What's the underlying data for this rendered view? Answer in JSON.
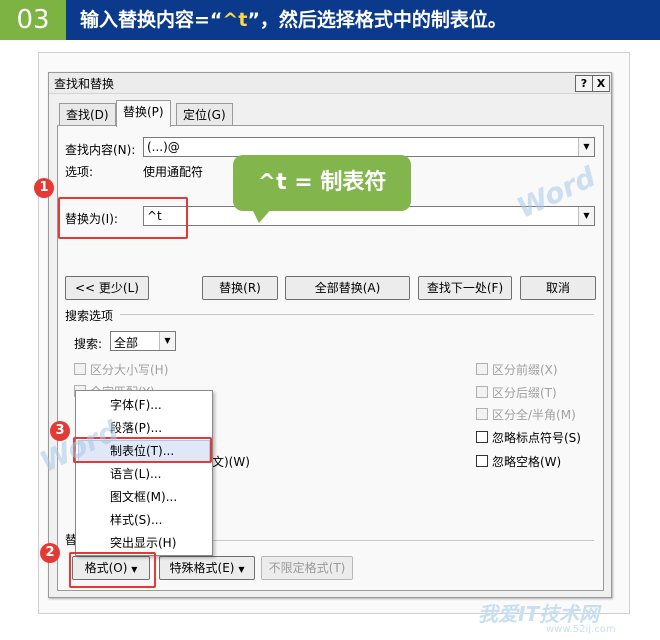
{
  "banner": {
    "step_number": "03",
    "text_before": "输入替换内容=“",
    "text_highlight": "^t",
    "text_after": "”，然后选择格式中的制表位。",
    "colors": {
      "bar": "#0b3a8d",
      "number_bg": "#7cb342",
      "highlight": "#ffd54a"
    }
  },
  "dialog": {
    "title": "查找和替换",
    "help_button": "?",
    "close_button": "X",
    "tabs": [
      {
        "label": "查找(D)"
      },
      {
        "label": "替换(P)"
      },
      {
        "label": "定位(G)"
      }
    ],
    "find": {
      "label": "查找内容(N):",
      "value": "(...)@"
    },
    "options": {
      "label": "选项:",
      "value": "使用通配符"
    },
    "replace": {
      "label": "替换为(I):",
      "value": "^t"
    },
    "buttons": {
      "less": "<< 更少(L)",
      "replace": "替换(R)",
      "replace_all": "全部替换(A)",
      "find_next": "查找下一处(F)",
      "cancel": "取消"
    },
    "search_options": {
      "section_title": "搜索选项",
      "search_label": "搜索:",
      "search_value": "全部",
      "left_checkboxes": [
        {
          "label": "区分大小写(H)"
        },
        {
          "label": "全字匹配(Y)"
        }
      ],
      "partial_label": "文)(W)",
      "right_checkboxes": [
        {
          "label": "区分前缀(X)"
        },
        {
          "label": "区分后缀(T)"
        },
        {
          "label": "区分全/半角(M)"
        },
        {
          "label": "忽略标点符号(S)"
        },
        {
          "label": "忽略空格(W)"
        }
      ]
    },
    "replace_section_partial": "替",
    "bottom_buttons": {
      "format": "格式(O)",
      "special": "特殊格式(E)",
      "no_format": "不限定格式(T)"
    }
  },
  "format_menu": {
    "items": [
      {
        "label": "字体(F)..."
      },
      {
        "label": "段落(P)..."
      },
      {
        "label": "制表位(T)..."
      },
      {
        "label": "语言(L)..."
      },
      {
        "label": "图文框(M)..."
      },
      {
        "label": "样式(S)..."
      },
      {
        "label": "突出显示(H)"
      }
    ]
  },
  "callout": {
    "text": "^t = 制表符"
  },
  "steps": {
    "one": "1",
    "two": "2",
    "three": "3"
  },
  "watermarks": {
    "word": "Word",
    "site_name": "我爱IT技术网",
    "site_url": "www.52ij.com"
  }
}
